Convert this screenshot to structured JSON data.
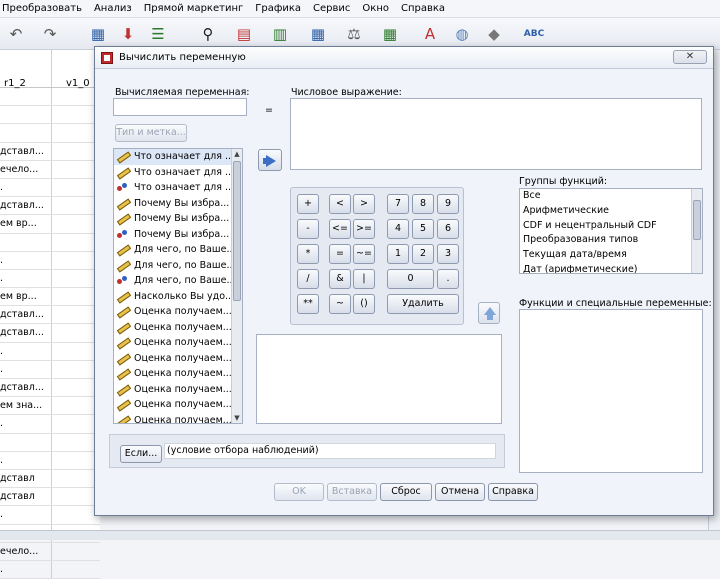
{
  "menubar": {
    "items": [
      "Преобразовать",
      "Анализ",
      "Прямой маркетинг",
      "Графика",
      "Сервис",
      "Окно",
      "Справка"
    ]
  },
  "toolbar": {
    "icons": [
      "undo-icon",
      "redo-icon",
      "goto-case-icon",
      "goto-variable-icon",
      "variables-icon",
      "find-icon",
      "insert-cases-icon",
      "insert-variable-icon",
      "split-file-icon",
      "weight-cases-icon",
      "select-cases-icon",
      "value-labels-icon",
      "use-sets-icon",
      "show-sets-icon",
      "spell-check-icon"
    ],
    "spell_label": "ABC"
  },
  "data_editor": {
    "columns": [
      "r1_2",
      "v1_0"
    ],
    "cells": [
      "",
      "",
      "",
      "дставл...",
      "ечело...",
      ".",
      "дставл...",
      "ем вр...",
      "",
      ".",
      ".",
      "ем вр...",
      "дставл...",
      "дставл...",
      ".",
      ".",
      "дставл...",
      "ем зна...",
      ".",
      "",
      ".",
      "дставл",
      "дставл",
      ".",
      "ечело...",
      "ечело...",
      "."
    ]
  },
  "dialog": {
    "title": "Вычислить переменную",
    "close_label": "✕",
    "target_label": "Вычисляемая переменная:",
    "target_value": "",
    "equals": "=",
    "expression_label": "Числовое выражение:",
    "expression_value": "",
    "type_label_button": "Тип и метка...",
    "variables": [
      {
        "name": "Что означает для ...",
        "icon": "scale-icon",
        "selected": true
      },
      {
        "name": "Что означает для ...",
        "icon": "scale-icon"
      },
      {
        "name": "Что означает для ...",
        "icon": "nominal-icon"
      },
      {
        "name": "Почему Вы избра...",
        "icon": "scale-icon"
      },
      {
        "name": "Почему Вы избра...",
        "icon": "scale-icon"
      },
      {
        "name": "Почему Вы избра...",
        "icon": "nominal-icon"
      },
      {
        "name": "Для чего, по Ваше...",
        "icon": "scale-icon"
      },
      {
        "name": "Для чего, по Ваше...",
        "icon": "scale-icon"
      },
      {
        "name": "Для чего, по Ваше...",
        "icon": "nominal-icon"
      },
      {
        "name": "Насколько Вы удо...",
        "icon": "scale-icon"
      },
      {
        "name": "Оценка получаем...",
        "icon": "scale-icon"
      },
      {
        "name": "Оценка получаем...",
        "icon": "scale-icon"
      },
      {
        "name": "Оценка получаем...",
        "icon": "scale-icon"
      },
      {
        "name": "Оценка получаем...",
        "icon": "scale-icon"
      },
      {
        "name": "Оценка получаем...",
        "icon": "scale-icon"
      },
      {
        "name": "Оценка получаем...",
        "icon": "scale-icon"
      },
      {
        "name": "Оценка получаем...",
        "icon": "scale-icon"
      },
      {
        "name": "Оценка получаем...",
        "icon": "scale-icon"
      }
    ],
    "keypad": {
      "keys": [
        "+",
        "<",
        ">",
        "7",
        "8",
        "9",
        "-",
        "<=",
        ">=",
        "4",
        "5",
        "6",
        "*",
        "=",
        "~=",
        "1",
        "2",
        "3",
        "/",
        "&",
        "|",
        "0",
        ".",
        "**",
        "~",
        "()",
        "Удалить"
      ]
    },
    "function_groups_label": "Группы функций:",
    "function_groups": [
      "Все",
      "Арифметические",
      "CDF и нецентральный CDF",
      "Преобразования типов",
      "Текущая дата/время",
      "Дат (арифметические)"
    ],
    "functions_label": "Функции и специальные переменные:",
    "if_button": "Если...",
    "if_text": "(условие отбора наблюдений)",
    "buttons": {
      "ok": "OK",
      "paste": "Вставка",
      "reset": "Сброс",
      "cancel": "Отмена",
      "help": "Справка"
    }
  }
}
